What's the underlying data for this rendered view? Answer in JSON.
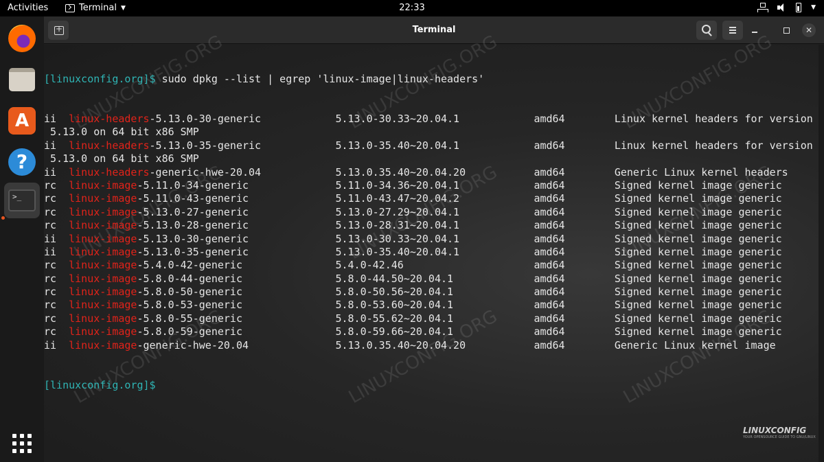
{
  "topbar": {
    "activities": "Activities",
    "app_name": "Terminal",
    "clock": "22:33"
  },
  "dock": {
    "items": [
      "firefox-icon",
      "files-icon",
      "software-icon",
      "help-icon",
      "terminal-icon",
      "show-apps-icon"
    ]
  },
  "window": {
    "title": "Terminal"
  },
  "terminal": {
    "prompt": "[linuxconfig.org]$",
    "command": " sudo dpkg --list | egrep 'linux-image|linux-headers'",
    "rows": [
      {
        "pre": "ii  ",
        "hl": "linux-headers",
        "post": "-5.13.0-30-generic            5.13.0-30.33~20.04.1            amd64        Linux kernel headers for version"
      },
      {
        "pre": " 5.13.0 on 64 bit x86 SMP",
        "hl": "",
        "post": ""
      },
      {
        "pre": "ii  ",
        "hl": "linux-headers",
        "post": "-5.13.0-35-generic            5.13.0-35.40~20.04.1            amd64        Linux kernel headers for version"
      },
      {
        "pre": " 5.13.0 on 64 bit x86 SMP",
        "hl": "",
        "post": ""
      },
      {
        "pre": "ii  ",
        "hl": "linux-headers",
        "post": "-generic-hwe-20.04            5.13.0.35.40~20.04.20           amd64        Generic Linux kernel headers"
      },
      {
        "pre": "rc  ",
        "hl": "linux-image",
        "post": "-5.11.0-34-generic              5.11.0-34.36~20.04.1            amd64        Signed kernel image generic"
      },
      {
        "pre": "rc  ",
        "hl": "linux-image",
        "post": "-5.11.0-43-generic              5.11.0-43.47~20.04.2            amd64        Signed kernel image generic"
      },
      {
        "pre": "rc  ",
        "hl": "linux-image",
        "post": "-5.13.0-27-generic              5.13.0-27.29~20.04.1            amd64        Signed kernel image generic"
      },
      {
        "pre": "rc  ",
        "hl": "linux-image",
        "post": "-5.13.0-28-generic              5.13.0-28.31~20.04.1            amd64        Signed kernel image generic"
      },
      {
        "pre": "ii  ",
        "hl": "linux-image",
        "post": "-5.13.0-30-generic              5.13.0-30.33~20.04.1            amd64        Signed kernel image generic"
      },
      {
        "pre": "ii  ",
        "hl": "linux-image",
        "post": "-5.13.0-35-generic              5.13.0-35.40~20.04.1            amd64        Signed kernel image generic"
      },
      {
        "pre": "rc  ",
        "hl": "linux-image",
        "post": "-5.4.0-42-generic               5.4.0-42.46                     amd64        Signed kernel image generic"
      },
      {
        "pre": "rc  ",
        "hl": "linux-image",
        "post": "-5.8.0-44-generic               5.8.0-44.50~20.04.1             amd64        Signed kernel image generic"
      },
      {
        "pre": "rc  ",
        "hl": "linux-image",
        "post": "-5.8.0-50-generic               5.8.0-50.56~20.04.1             amd64        Signed kernel image generic"
      },
      {
        "pre": "rc  ",
        "hl": "linux-image",
        "post": "-5.8.0-53-generic               5.8.0-53.60~20.04.1             amd64        Signed kernel image generic"
      },
      {
        "pre": "rc  ",
        "hl": "linux-image",
        "post": "-5.8.0-55-generic               5.8.0-55.62~20.04.1             amd64        Signed kernel image generic"
      },
      {
        "pre": "rc  ",
        "hl": "linux-image",
        "post": "-5.8.0-59-generic               5.8.0-59.66~20.04.1             amd64        Signed kernel image generic"
      },
      {
        "pre": "ii  ",
        "hl": "linux-image",
        "post": "-generic-hwe-20.04              5.13.0.35.40~20.04.20           amd64        Generic Linux kernel image"
      }
    ],
    "final_prompt": "[linuxconfig.org]$"
  },
  "watermark": {
    "text": "LINUXCONFIG.ORG",
    "brand": "LINUXCONFIG",
    "brand_tagline": "YOUR OPENSOURCE GUIDE TO GNU/LINUX"
  },
  "colors": {
    "prompt": "#2fb5b5",
    "highlight": "#e2231a",
    "text": "#e6e6e6"
  }
}
